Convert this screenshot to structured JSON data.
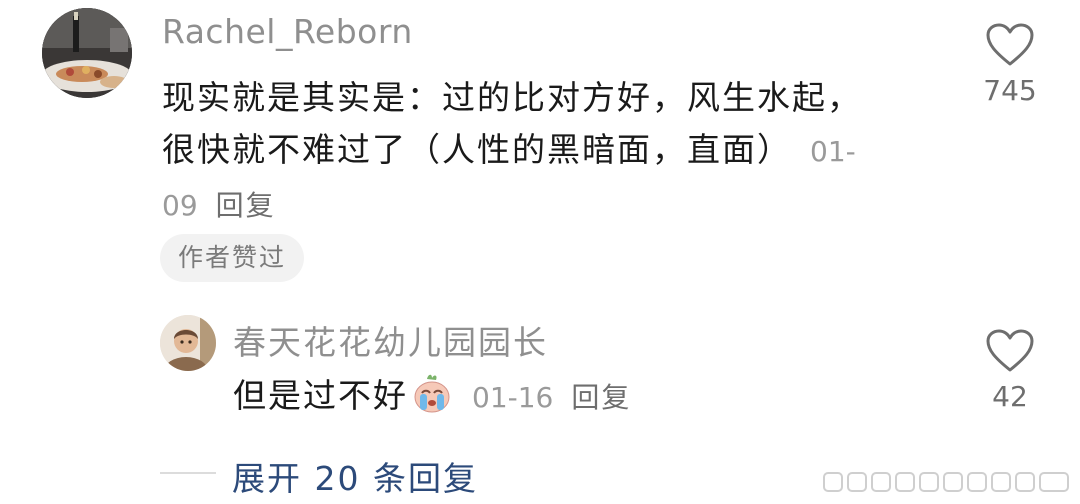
{
  "comment": {
    "username": "Rachel_Reborn",
    "text": "现实就是其实是：过的比对方好，风生水起，很快就不难过了（人性的黑暗面，直面）",
    "date": "01-09",
    "reply_label": "回复",
    "author_badge": "作者赞过",
    "likes": "745"
  },
  "reply": {
    "username": "春天花花幼儿园园长",
    "text": "但是过不好",
    "emoji": "crying-face-emoji",
    "date": "01-16",
    "reply_label": "回复",
    "likes": "42"
  },
  "expand": {
    "label": "展开 20 条回复"
  },
  "colors": {
    "username": "#8f8f8f",
    "link": "#2c4a7a",
    "badge_bg": "#f2f2f2"
  }
}
